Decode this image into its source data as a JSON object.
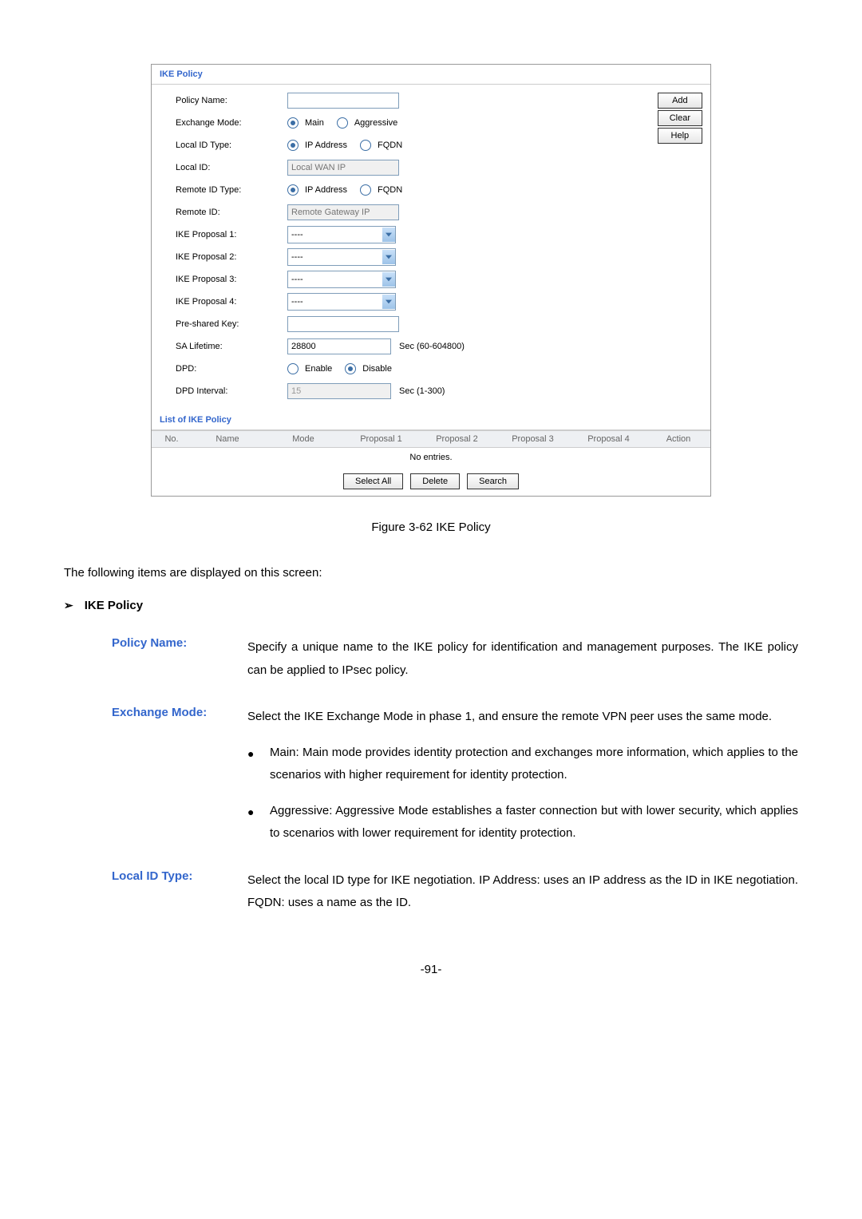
{
  "screenshot": {
    "section1_title": "IKE Policy",
    "fields": {
      "policy_name": {
        "label": "Policy Name:",
        "value": ""
      },
      "exchange_mode": {
        "label": "Exchange Mode:",
        "opt1": "Main",
        "opt2": "Aggressive"
      },
      "local_id_type": {
        "label": "Local ID Type:",
        "opt1": "IP Address",
        "opt2": "FQDN"
      },
      "local_id": {
        "label": "Local ID:",
        "placeholder": "Local WAN IP"
      },
      "remote_id_type": {
        "label": "Remote ID Type:",
        "opt1": "IP Address",
        "opt2": "FQDN"
      },
      "remote_id": {
        "label": "Remote ID:",
        "placeholder": "Remote Gateway IP"
      },
      "ike_proposal_1": {
        "label": "IKE Proposal 1:",
        "value": "----"
      },
      "ike_proposal_2": {
        "label": "IKE Proposal 2:",
        "value": "----"
      },
      "ike_proposal_3": {
        "label": "IKE Proposal 3:",
        "value": "----"
      },
      "ike_proposal_4": {
        "label": "IKE Proposal 4:",
        "value": "----"
      },
      "preshared_key": {
        "label": "Pre-shared Key:",
        "value": ""
      },
      "sa_lifetime": {
        "label": "SA Lifetime:",
        "value": "28800",
        "suffix": "Sec (60-604800)"
      },
      "dpd": {
        "label": "DPD:",
        "opt1": "Enable",
        "opt2": "Disable"
      },
      "dpd_interval": {
        "label": "DPD Interval:",
        "value": "15",
        "suffix": "Sec (1-300)"
      }
    },
    "buttons": {
      "add": "Add",
      "clear": "Clear",
      "help": "Help"
    },
    "section2_title": "List of IKE Policy",
    "table_headers": {
      "no": "No.",
      "name": "Name",
      "mode": "Mode",
      "p1": "Proposal 1",
      "p2": "Proposal 2",
      "p3": "Proposal 3",
      "p4": "Proposal 4",
      "action": "Action"
    },
    "no_entries": "No entries.",
    "list_buttons": {
      "select_all": "Select All",
      "delete": "Delete",
      "search": "Search"
    }
  },
  "figure_caption": "Figure 3-62 IKE Policy",
  "intro_text": "The following items are displayed on this screen:",
  "section_heading": "IKE Policy",
  "definitions": {
    "policy_name": {
      "term": "Policy Name:",
      "desc": "Specify a unique name to the IKE policy for identification and management purposes. The IKE policy can be applied to IPsec policy."
    },
    "exchange_mode": {
      "term": "Exchange Mode:",
      "desc": "Select the IKE Exchange Mode in phase 1, and ensure the remote VPN peer uses the same mode.",
      "bullet1": "Main: Main mode provides identity protection and exchanges more information, which applies to the scenarios with higher requirement for identity protection.",
      "bullet2": "Aggressive: Aggressive Mode establishes a faster connection but with lower security, which applies to scenarios with lower requirement for identity protection."
    },
    "local_id_type": {
      "term": "Local ID Type:",
      "desc": "Select the local ID type for IKE negotiation. IP Address: uses an IP address as the ID in IKE negotiation. FQDN: uses a name as the ID."
    }
  },
  "page_number": "-91-"
}
